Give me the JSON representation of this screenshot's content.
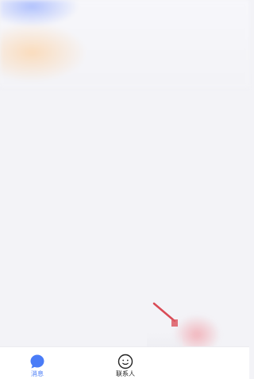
{
  "bottom_nav": {
    "items": [
      {
        "label": "消息",
        "icon": "chat-bubble-icon",
        "active": true
      },
      {
        "label": "联系人",
        "icon": "contacts-face-icon",
        "active": false
      }
    ]
  },
  "colors": {
    "accent": "#4a7cf7",
    "background": "#f3f3f7",
    "annotation": "#d94a55"
  }
}
